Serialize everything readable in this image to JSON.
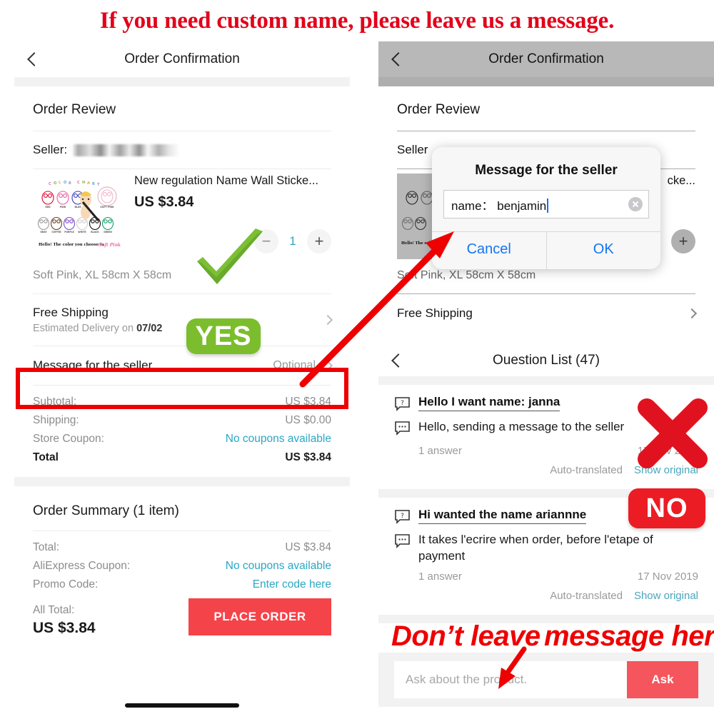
{
  "banner": {
    "text": "If you need custom name, please leave us a message."
  },
  "left_panel": {
    "navbar": {
      "title": "Order Confirmation",
      "back_icon": "chevron-left-icon"
    },
    "section_title": "Order Review",
    "seller": {
      "label": "Seller:",
      "value_blurred": true
    },
    "product": {
      "title": "New regulation Name Wall Sticke...",
      "price": "US $3.84",
      "quantity": "1",
      "minus_label": "−",
      "plus_label": "+",
      "variant": "Soft Pink, XL 58cm X 58cm",
      "thumb_alt": "color-chart-owl-wall-sticker"
    },
    "shipping": {
      "title": "Free Shipping",
      "subtitle_prefix": "Estimated Delivery on ",
      "subtitle_date": "07/02"
    },
    "message_row": {
      "label": "Message for the seller",
      "value": "Optional"
    },
    "totals": [
      {
        "k": "Subtotal:",
        "v": "US $3.84",
        "link": false,
        "bold": false
      },
      {
        "k": "Shipping:",
        "v": "US $0.00",
        "link": false,
        "bold": false
      },
      {
        "k": "Store Coupon:",
        "v": "No coupons available",
        "link": true,
        "bold": false
      },
      {
        "k": "Total",
        "v": "US $3.84",
        "link": false,
        "bold": true
      }
    ],
    "summary_title": "Order Summary (1 item)",
    "summary": [
      {
        "k": "Total:",
        "v": "US $3.84",
        "link": false
      },
      {
        "k": "AliExpress Coupon:",
        "v": "No coupons available",
        "link": true
      },
      {
        "k": "Promo Code:",
        "v": "Enter code here",
        "link": true
      }
    ],
    "all_total": {
      "label": "All Total:",
      "value": "US $3.84"
    },
    "place_order": "PLACE ORDER"
  },
  "right_panel": {
    "navbar": {
      "title": "Order Confirmation",
      "back_icon": "chevron-left-icon"
    },
    "section_title": "Order Review",
    "seller_label": "Seller",
    "product_title_tail": "cke...",
    "variant": "Soft Pink, XL 58cm X 58cm",
    "shipping_title": "Free Shipping",
    "plus_label": "+",
    "dialog": {
      "title": "Message for the seller",
      "input_value": "name： benjamin",
      "clear_icon": "clear-circle-icon",
      "cancel_label": "Cancel",
      "ok_label": "OK"
    },
    "question_list": {
      "navbar_title": "Ouestion List (47)",
      "back_icon": "chevron-left-icon",
      "items": [
        {
          "question": "Hello I want name: janna",
          "answer": "Hello, sending a message to the seller",
          "answer_count": "1 answer",
          "date": "17 Nov 2019",
          "auto_translated": "Auto-translated",
          "show_original": "Show original"
        },
        {
          "question": "Hi wanted the name ariannne",
          "answer": "It takes l'ecrire when order, before l'etape of payment",
          "answer_count": "1 answer",
          "date": "17 Nov 2019",
          "auto_translated": "Auto-translated",
          "show_original": "Show original"
        }
      ],
      "ask_placeholder": "Ask about the product.",
      "ask_button": "Ask"
    }
  },
  "annotations": {
    "yes_badge": "YES",
    "no_badge": "NO",
    "check_icon": "green-check-icon",
    "cross_icon": "red-cross-icon",
    "arrow_icon": "red-arrow-icon",
    "bottom_note_left": "Don’t leave",
    "bottom_note_right": "message here"
  },
  "colors": {
    "banner_red": "#e2001a",
    "highlight_red": "#ee0000",
    "yes_green": "#7bbd2c",
    "no_red": "#ec1c24",
    "place_order_red": "#f5434a",
    "ask_red": "#f5555c",
    "link_teal": "#2aa7c4",
    "ios_blue": "#1376f1"
  }
}
